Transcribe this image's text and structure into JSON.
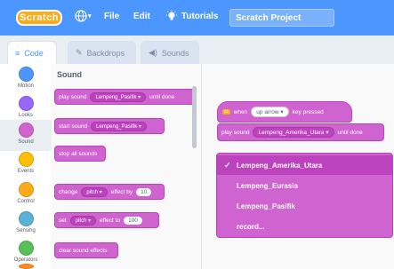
{
  "menu": {
    "logo": "Scratch",
    "file": "File",
    "edit": "Edit",
    "tutorials": "Tutorials",
    "project_title": "Scratch Project"
  },
  "tabs": [
    {
      "label": "Code",
      "icon": "code-icon"
    },
    {
      "label": "Backdrops",
      "icon": "paintbrush-icon"
    },
    {
      "label": "Sounds",
      "icon": "speaker-icon"
    }
  ],
  "categories": [
    {
      "label": "Motion",
      "color": "#4c97ff"
    },
    {
      "label": "Looks",
      "color": "#9966ff"
    },
    {
      "label": "Sound",
      "color": "#cf63cf"
    },
    {
      "label": "Events",
      "color": "#ffbf00"
    },
    {
      "label": "Control",
      "color": "#ffab19"
    },
    {
      "label": "Sensing",
      "color": "#5cb1d6"
    },
    {
      "label": "Operators",
      "color": "#59c059"
    }
  ],
  "palette": {
    "title": "Sound",
    "blocks": {
      "play_until_done": {
        "prefix": "play sound",
        "menu": "Lempeng_Pasifik",
        "suffix": "until done"
      },
      "start_sound": {
        "prefix": "start sound",
        "menu": "Lempeng_Pasifik"
      },
      "stop_all": "stop all sounds",
      "change_effect": {
        "prefix": "change",
        "menu": "pitch",
        "mid": "effect by",
        "value": "10"
      },
      "set_effect": {
        "prefix": "set",
        "menu": "pitch",
        "mid": "effect to",
        "value": "100"
      },
      "clear_effects": "clear sound effects"
    }
  },
  "script": {
    "hat": {
      "prefix": "when",
      "menu": "up arrow",
      "suffix": "key pressed"
    },
    "play": {
      "prefix": "play sound",
      "menu": "Lempeng_Amerika_Utara",
      "suffix": "until done"
    }
  },
  "dropdown": {
    "items": [
      "Lempeng_Amerika_Utara",
      "Lempeng_Eurasia",
      "Lempeng_Pasifik",
      "record..."
    ],
    "selected_index": 0,
    "check": "✓"
  },
  "colors": {
    "menubar": "#4c97ff",
    "sound": "#cf63cf",
    "sound_dark": "#bd42bd"
  }
}
